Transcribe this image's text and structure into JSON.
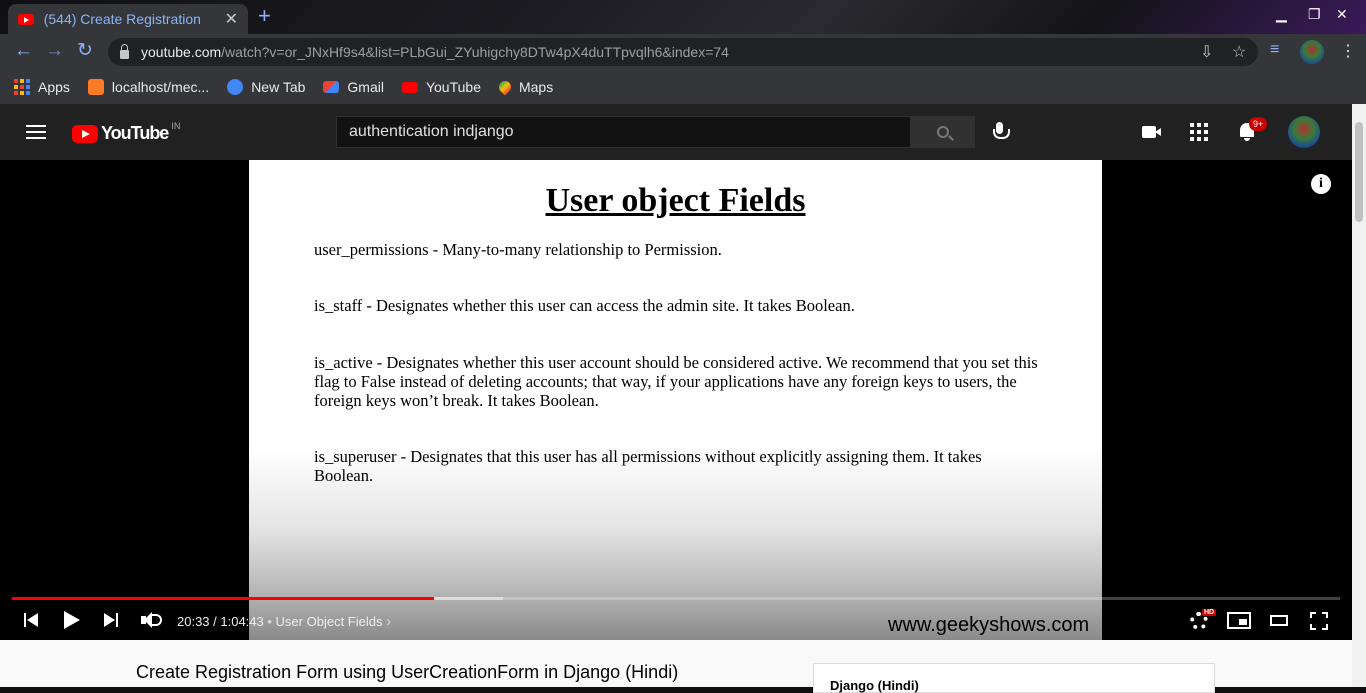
{
  "browser": {
    "tab_title": "(544) Create Registration",
    "url_host": "youtube.com",
    "url_rest": "/watch?v=or_JNxHf9s4&list=PLbGui_ZYuhigchy8DTw4pX4duTTpvqlh6&index=74",
    "bookmarks": [
      "Apps",
      "localhost/mec...",
      "New Tab",
      "Gmail",
      "YouTube",
      "Maps"
    ]
  },
  "youtube": {
    "country_code": "IN",
    "logo_text": "YouTube",
    "search_value": "authentication indjango",
    "notification_count": "9+"
  },
  "slide": {
    "title": "User object Fields",
    "paragraphs": [
      "user_permissions - Many-to-many relationship to Permission.",
      "is_staff - Designates whether this user can access the admin site. It takes Boolean.",
      "is_active - Designates whether this user account should be considered active. We recommend that you set this flag to False instead of deleting accounts; that way, if your applications have any foreign keys to users, the foreign keys won’t break. It takes Boolean.",
      "is_superuser - Designates that this user has all permissions without explicitly assigning them. It takes Boolean."
    ],
    "watermark": "www.geekyshows.com"
  },
  "player": {
    "time_display": "20:33 / 1:04:43",
    "chapter": "User Object Fields",
    "progress_fraction": 0.318,
    "buffered_fraction": 0.37,
    "hd_badge": "HD"
  },
  "below": {
    "video_title": "Create Registration Form using UserCreationForm in Django (Hindi)",
    "playlist_title": "Django (Hindi)"
  },
  "colors": {
    "accent_blue": "#8ab4f8",
    "youtube_red": "#ff0000"
  }
}
